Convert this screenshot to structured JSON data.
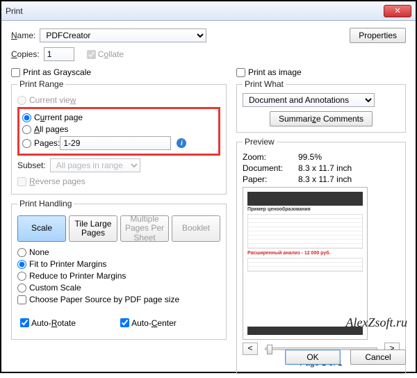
{
  "window": {
    "title": "Print"
  },
  "name": {
    "label": "Name:",
    "value": "PDFCreator",
    "properties_btn": "Properties"
  },
  "copies": {
    "label": "Copies:",
    "value": "1",
    "collate": "Collate"
  },
  "grayscale": "Print as Grayscale",
  "print_as_image": "Print as image",
  "range": {
    "legend": "Print Range",
    "current_view": "Current view",
    "current_page": "Current page",
    "all_pages": "All pages",
    "pages_label": "Pages:",
    "pages_value": "1-29",
    "subset_label": "Subset:",
    "subset_value": "All pages in range",
    "reverse": "Reverse pages"
  },
  "handling": {
    "legend": "Print Handling",
    "tabs": {
      "scale": "Scale",
      "tile": "Tile Large Pages",
      "multi": "Multiple Pages Per Sheet",
      "booklet": "Booklet"
    },
    "none": "None",
    "fit": "Fit to Printer Margins",
    "reduce": "Reduce to Printer Margins",
    "custom": "Custom Scale",
    "paper_source": "Choose Paper Source by PDF page size",
    "auto_rotate": "Auto-Rotate",
    "auto_center": "Auto-Center"
  },
  "what": {
    "legend": "Print What",
    "value": "Document and Annotations",
    "summarize": "Summarize Comments"
  },
  "preview": {
    "legend": "Preview",
    "zoom_l": "Zoom:",
    "zoom_v": "99.5%",
    "doc_l": "Document:",
    "doc_v": "8.3 x 11.7 inch",
    "paper_l": "Paper:",
    "paper_v": "8.3 x 11.7 inch",
    "red_text": "Расширенный анализ - 12 000 руб.",
    "page_of": "Page 1 of 1"
  },
  "footer": {
    "ok": "OK",
    "cancel": "Cancel"
  },
  "watermark": "AlexZsoft.ru"
}
